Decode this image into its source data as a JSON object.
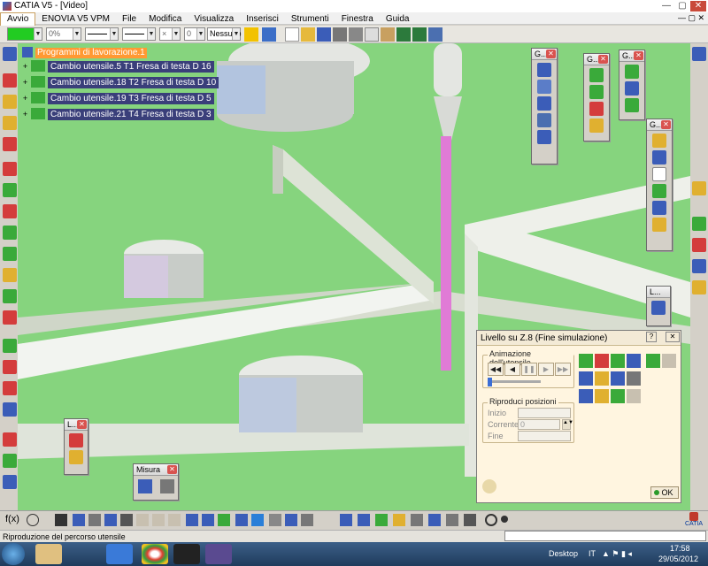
{
  "window": {
    "title": "CATIA V5 - [Video]",
    "controls": [
      "minimize",
      "maximize",
      "close"
    ]
  },
  "menubar": {
    "items": [
      "Avvio",
      "ENOVIA V5 VPM",
      "File",
      "Modifica",
      "Visualizza",
      "Inserisci",
      "Strumenti",
      "Finestra",
      "Guida"
    ],
    "active_index": 0
  },
  "toolbar": {
    "color_value": "",
    "transparency_value": "0%",
    "line_type_value": "",
    "line_weight_value": "",
    "point_value": "",
    "layer_value": "0",
    "layer_filter_value": "Nessuno"
  },
  "tree": {
    "root_label": "Programmi di lavorazione.1",
    "items": [
      {
        "label": "Cambio utensile.5  T1 Fresa di testa D 16"
      },
      {
        "label": "Cambio utensile.18  T2 Fresa di testa D 10"
      },
      {
        "label": "Cambio utensile.19  T3 Fresa di testa D 5"
      },
      {
        "label": "Cambio utensile.21  T4 Fresa di testa D 3"
      }
    ]
  },
  "palettes": {
    "p1_title": "G...",
    "p2_title": "G...",
    "p3_title": "G...",
    "p4_title": "G...",
    "p5_title": "L...",
    "p6_title": "L...",
    "measure_title": "Misura"
  },
  "dialog": {
    "title": "Livello su Z.8 (Fine simulazione)",
    "animation_group": "Animazione dell'utensile",
    "replay_group": "Riproduci posizioni",
    "start_label": "Inizio",
    "current_label": "Corrente",
    "current_value": "0",
    "end_label": "Fine",
    "ok_label": "OK"
  },
  "status": {
    "text": "Riproduzione del percorso utensile"
  },
  "taskbar": {
    "desktop_label": "Desktop",
    "lang": "IT",
    "time": "17:58",
    "date": "29/05/2012"
  },
  "brand": {
    "catia_label": "CATIA"
  },
  "colors": {
    "viewport_bg": "#86d47e",
    "tree_highlight": "#ff9933",
    "tree_item_bg": "#3a3f7a",
    "tool_pink": "#e07bd6",
    "dialog_bg": "#fff5e0"
  }
}
